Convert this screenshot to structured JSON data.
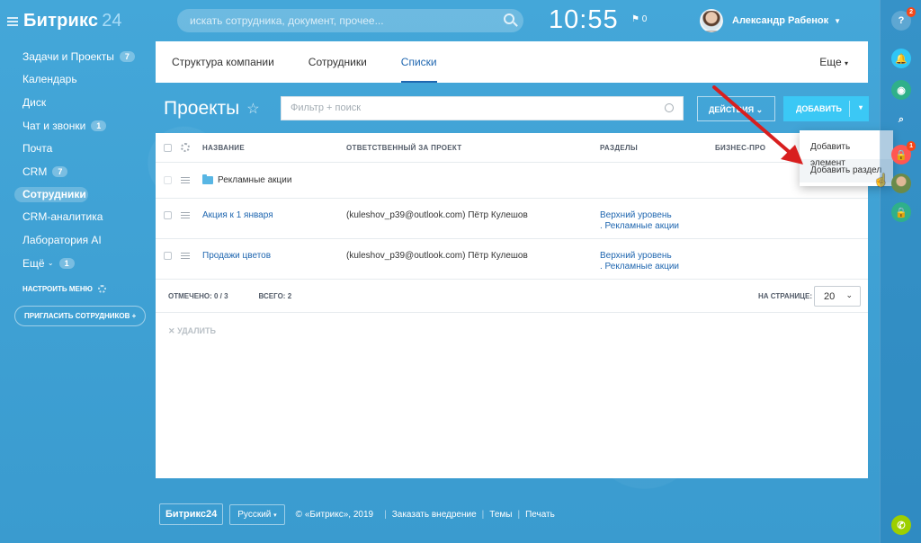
{
  "header": {
    "logo": "Битрикс",
    "logo_num": "24",
    "search_placeholder": "искать сотрудника, документ, прочее...",
    "time": "10:55",
    "flag_count": "0",
    "user_name": "Александр Рабенок"
  },
  "sidebar": {
    "items": [
      {
        "label": "Задачи и Проекты",
        "badge": "7"
      },
      {
        "label": "Календарь",
        "badge": ""
      },
      {
        "label": "Диск",
        "badge": ""
      },
      {
        "label": "Чат и звонки",
        "badge": "1"
      },
      {
        "label": "Почта",
        "badge": ""
      },
      {
        "label": "CRM",
        "badge": "7"
      },
      {
        "label": "Сотрудники",
        "badge": ""
      },
      {
        "label": "CRM-аналитика",
        "badge": ""
      },
      {
        "label": "Лаборатория AI",
        "badge": ""
      },
      {
        "label": "Ещё",
        "badge": "1"
      }
    ],
    "setup_label": "НАСТРОИТЬ МЕНЮ",
    "invite_label": "ПРИГЛАСИТЬ СОТРУДНИКОВ"
  },
  "tabs": {
    "items": [
      "Структура компании",
      "Сотрудники",
      "Списки"
    ],
    "more": "Еще"
  },
  "toolbar": {
    "title": "Проекты",
    "filter_placeholder": "Фильтр + поиск",
    "actions_label": "ДЕЙСТВИЯ",
    "add_label": "ДОБАВИТЬ"
  },
  "grid": {
    "columns": [
      "НАЗВАНИЕ",
      "ОТВЕТСТВЕННЫЙ ЗА ПРОЕКТ",
      "РАЗДЕЛЫ",
      "БИЗНЕС-ПРО"
    ],
    "folder_row": "Рекламные акции",
    "rows": [
      {
        "name": "Акция к 1 января",
        "resp": "(kuleshov_p39@outlook.com) Пётр Кулешов",
        "sect1": "Верхний уровень",
        "sect2": ". Рекламные акции"
      },
      {
        "name": "Продажи цветов",
        "resp": "(kuleshov_p39@outlook.com) Пётр Кулешов",
        "sect1": "Верхний уровень",
        "sect2": ". Рекламные акции"
      }
    ],
    "marked_label": "ОТМЕЧЕНО:",
    "marked_value": "0 / 3",
    "total_label": "ВСЕГО:",
    "total_value": "2",
    "per_page_label": "НА СТРАНИЦЕ:",
    "per_page_value": "20",
    "delete_label": "УДАЛИТЬ"
  },
  "popup": {
    "items": [
      "Добавить элемент",
      "Добавить раздел"
    ]
  },
  "rail": {
    "help_badge": "2",
    "lock_badge": "1"
  },
  "footer": {
    "logo": "Битрикс24",
    "lang": "Русский",
    "copyright": "© «Битрикс», 2019",
    "links": [
      "Заказать внедрение",
      "Темы",
      "Печать"
    ]
  },
  "colors": {
    "background": "#3d9fd2",
    "link": "#2067b0",
    "add_button": "#3bc8f5",
    "arrow": "#d81f1f",
    "badge": "#f54819"
  }
}
